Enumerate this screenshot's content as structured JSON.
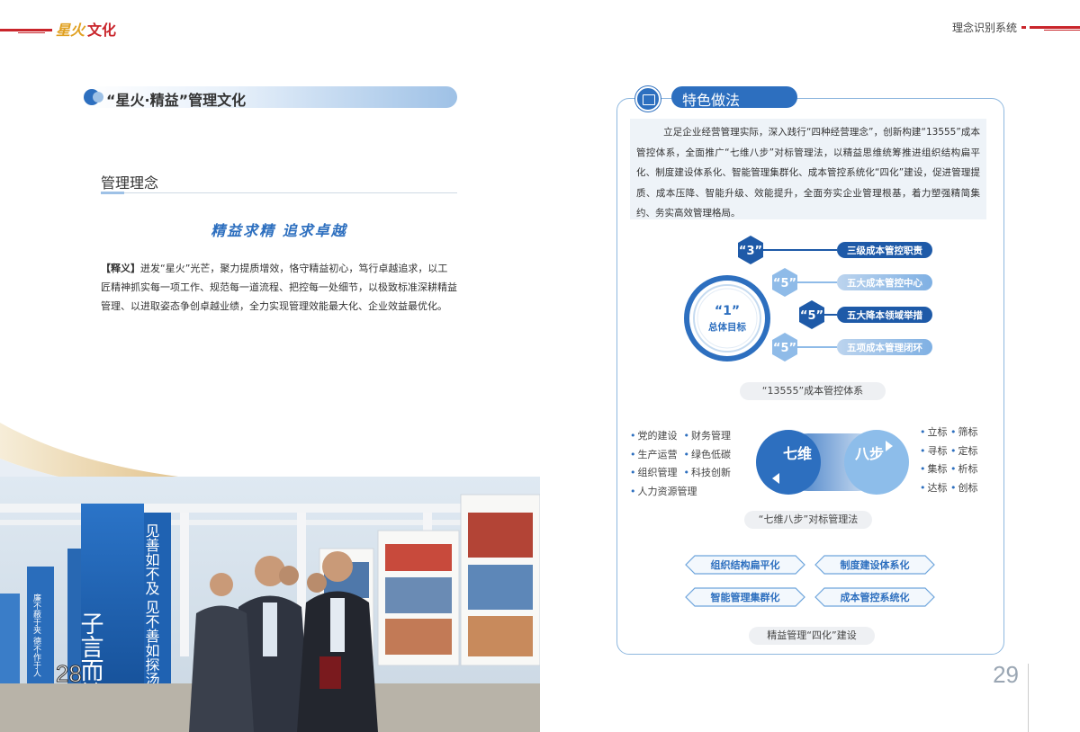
{
  "header": {
    "logo_signature": "星火",
    "logo_text": "文化",
    "right_title": "理念识别系统"
  },
  "left": {
    "section_title": "“星火·精益”管理文化",
    "subsection_title": "管理理念",
    "motto": "精益求精  追求卓越",
    "definition_label": "【释义】",
    "definition_text": "迸发“星火”光芒，聚力提质增效，恪守精益初心，笃行卓越追求，以工匠精神抓实每一项工作、规范每一道流程、把控每一处细节，以极致标准深耕精益管理、以进取姿态争创卓越业绩，全力实现管理效能最大化、企业效益最优化。",
    "page_number": "28",
    "photo_sign_1": "子言而敏于行",
    "photo_sign_2": "见善如不及  见不善如探汤",
    "photo_sign_3": "廉不蔽于夹  德不作于人"
  },
  "right": {
    "section_title": "特色做法",
    "intro": "立足企业经营管理实际，深入践行“四种经营理念”，创新构建“13555”成本管控体系，全面推广“七维八步”对标管理法，以精益思维统筹推进组织结构扁平化、制度建设体系化、智能管理集群化、成本管控系统化“四化”建设，促进管理提质、成本压降、智能升级、效能提升，全面夯实企业管理根基，着力塑强精简集约、务实高效管理格局。",
    "diagram1": {
      "center_num": "“1”",
      "center_label": "总体目标",
      "items": [
        {
          "num": "“3”",
          "label": "三级成本管控职责"
        },
        {
          "num": "“5”",
          "label": "五大成本管控中心"
        },
        {
          "num": "“5”",
          "label": "五大降本领域举措"
        },
        {
          "num": "“5”",
          "label": "五项成本管理闭环"
        }
      ],
      "caption": "“13555”成本管控体系"
    },
    "diagram2": {
      "left_circle": "七维",
      "right_circle": "八步",
      "left_items": [
        "党的建设",
        "财务管理",
        "生产运营",
        "绿色低碳",
        "组织管理",
        "科技创新",
        "人力资源管理"
      ],
      "right_items": [
        "立标",
        "筛标",
        "寻标",
        "定标",
        "集标",
        "析标",
        "达标",
        "创标"
      ],
      "caption": "“七维八步”对标管理法"
    },
    "diagram3": {
      "items": [
        "组织结构扁平化",
        "制度建设体系化",
        "智能管理集群化",
        "成本管控系统化"
      ],
      "caption": "精益管理“四化”建设"
    },
    "page_number": "29"
  },
  "colors": {
    "brand_red": "#c9252b",
    "primary_blue": "#2d6fbf",
    "light_blue": "#9ec1e6"
  }
}
